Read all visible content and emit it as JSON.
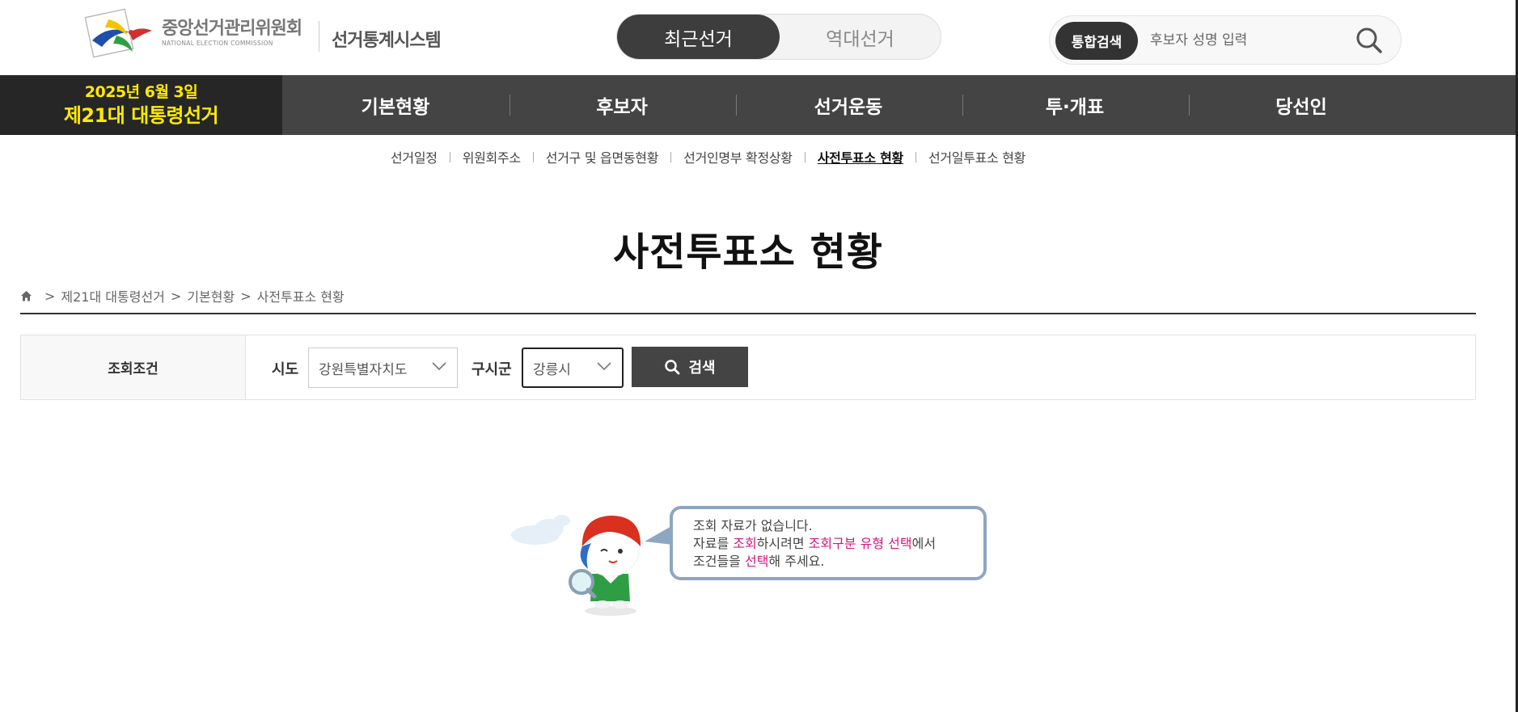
{
  "header": {
    "org_name_ko": "중앙선거관리위원회",
    "org_name_en": "NATIONAL ELECTION COMMISSION",
    "system_name": "선거통계시스템",
    "toggle": {
      "recent": "최근선거",
      "past": "역대선거",
      "active": "recent"
    },
    "search": {
      "badge": "통합검색",
      "placeholder": "후보자 성명 입력",
      "value": ""
    }
  },
  "election": {
    "date": "2025년 6월 3일",
    "name": "제21대 대통령선거"
  },
  "nav": {
    "items": [
      {
        "label": "기본현황"
      },
      {
        "label": "후보자"
      },
      {
        "label": "선거운동"
      },
      {
        "label": "투·개표"
      },
      {
        "label": "당선인"
      }
    ]
  },
  "subnav": {
    "items": [
      {
        "label": "선거일정",
        "active": false
      },
      {
        "label": "위원회주소",
        "active": false
      },
      {
        "label": "선거구 및 읍면동현황",
        "active": false
      },
      {
        "label": "선거인명부 확정상황",
        "active": false
      },
      {
        "label": "사전투표소 현황",
        "active": true
      },
      {
        "label": "선거일투표소 현황",
        "active": false
      }
    ]
  },
  "page": {
    "title": "사전투표소 현황",
    "breadcrumb": {
      "sep": ">",
      "items": [
        "제21대 대통령선거",
        "기본현황",
        "사전투표소 현황"
      ]
    }
  },
  "filter": {
    "label": "조회조건",
    "sido_label": "시도",
    "sido_value": "강원특별자치도",
    "sigungu_label": "구시군",
    "sigungu_value": "강릉시",
    "search_button": "검색"
  },
  "empty": {
    "line1": "조회 자료가 없습니다.",
    "line2": {
      "a": "자료를 ",
      "b": "조회",
      "c": "하시려면 ",
      "d": "조회구분 유형 선택",
      "e": "에서"
    },
    "line3": {
      "a": "조건들을 ",
      "b": "선택",
      "c": "해 주세요."
    }
  },
  "colors": {
    "nav_bg": "#444444",
    "badge_bg": "#262626",
    "election_yellow": "#ffea00",
    "highlight_pink": "#d6177a",
    "bubble_border": "#8fa6c2"
  }
}
